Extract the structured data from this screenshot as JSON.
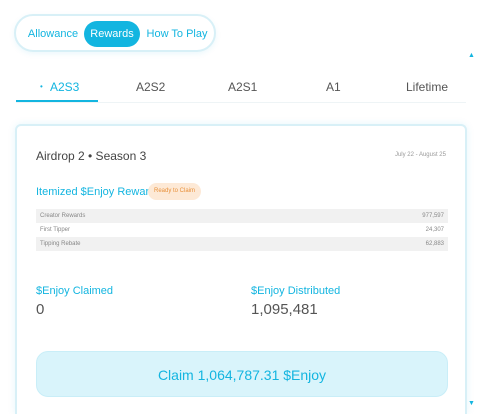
{
  "nav": {
    "segments": [
      "Allowance",
      "Rewards",
      "How To Play"
    ],
    "active_segment": "Rewards"
  },
  "season_tabs": {
    "items": [
      "A2S3",
      "A2S2",
      "A2S1",
      "A1",
      "Lifetime"
    ],
    "active": "A2S3"
  },
  "card": {
    "title": "Airdrop 2 • Season 3",
    "dates": "July 22 - August 25",
    "itemized_title": "Itemized $Enjoy Rewards",
    "status_badge": "Ready to Claim",
    "rows": [
      {
        "label": "Creator Rewards",
        "value": "977,597"
      },
      {
        "label": "First Tipper",
        "value": "24,307"
      },
      {
        "label": "Tipping Rebate",
        "value": "62,883"
      }
    ],
    "claimed_label": "$Enjoy Claimed",
    "claimed_value": "0",
    "distributed_label": "$Enjoy Distributed",
    "distributed_value": "1,095,481",
    "claim_button": "Claim 1,064,787.31 $Enjoy"
  },
  "colors": {
    "accent": "#13b5e0",
    "badge_text": "#e8903a",
    "badge_bg": "#fde9d6",
    "button_bg": "#d9f4fb"
  },
  "icons": {
    "scroll_up": "triangle-up",
    "scroll_down": "triangle-down",
    "active_tab_marker": "dot"
  }
}
